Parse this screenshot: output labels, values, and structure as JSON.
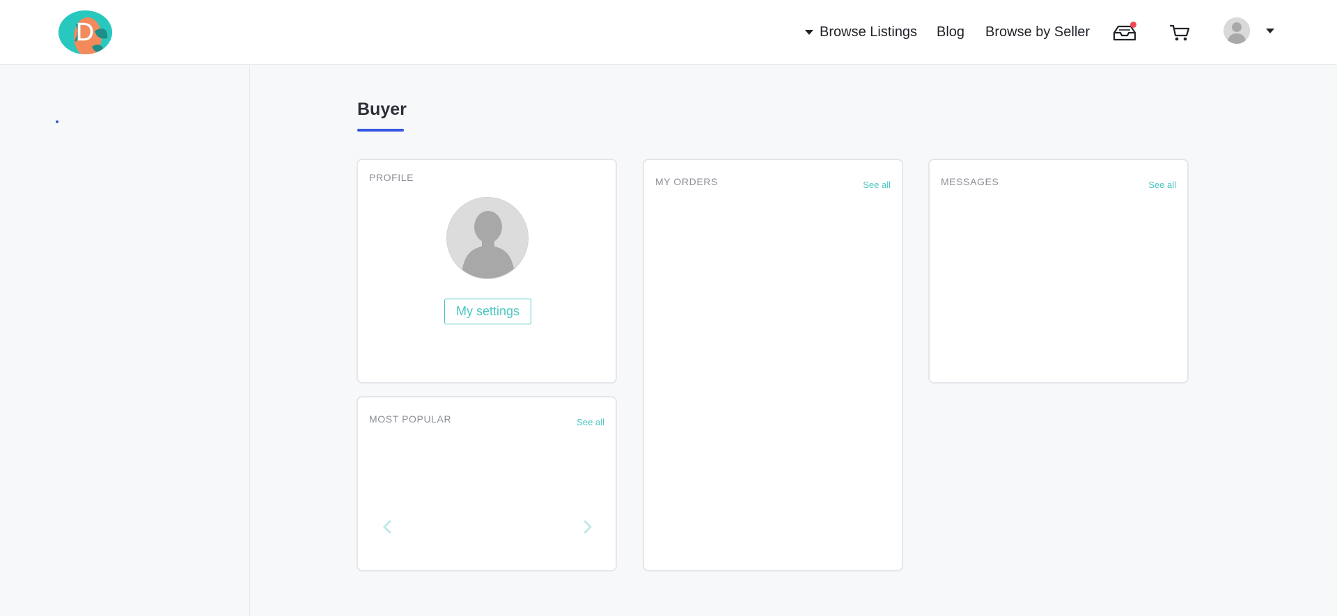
{
  "header": {
    "logo_letter": "D",
    "nav": {
      "browse_listings": "Browse Listings",
      "blog": "Blog",
      "browse_by_seller": "Browse by Seller"
    },
    "icons": [
      "inbox-icon",
      "cart-icon",
      "user-avatar",
      "chevron-down-icon"
    ],
    "notification_badge_color": "#ef4a5a"
  },
  "page": {
    "title": "Buyer",
    "accent_color": "#3557e0"
  },
  "cards": {
    "profile": {
      "label": "PROFILE",
      "settings_button": "My settings"
    },
    "orders": {
      "label": "MY ORDERS",
      "see_all": "See all"
    },
    "messages": {
      "label": "MESSAGES",
      "see_all": "See all"
    },
    "most_popular": {
      "label": "MOST POPULAR",
      "see_all": "See all"
    }
  },
  "colors": {
    "teal": "#49c6c0",
    "background": "#f7f8fa",
    "card_border": "#e4e6ea"
  }
}
